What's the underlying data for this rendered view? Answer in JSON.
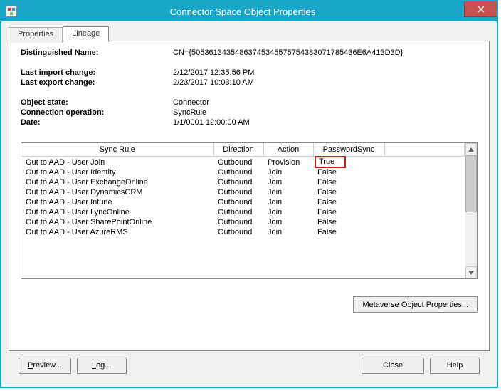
{
  "window": {
    "title": "Connector Space Object Properties"
  },
  "tabs": {
    "properties": "Properties",
    "lineage": "Lineage"
  },
  "meta": {
    "dn_label": "Distinguished Name:",
    "dn_value": "CN={50536134354863745345575754383071785436E6A413D3D}",
    "last_import_label": "Last import change:",
    "last_import_value": "2/12/2017 12:35:56 PM",
    "last_export_label": "Last export change:",
    "last_export_value": "2/23/2017 10:03:10 AM",
    "object_state_label": "Object state:",
    "object_state_value": "Connector",
    "conn_op_label": "Connection operation:",
    "conn_op_value": "SyncRule",
    "date_label": "Date:",
    "date_value": "1/1/0001 12:00:00 AM"
  },
  "columns": {
    "syncrule": "Sync Rule",
    "direction": "Direction",
    "action": "Action",
    "passwordsync": "PasswordSync"
  },
  "rows": [
    {
      "rule": "Out to AAD - User Join",
      "dir": "Outbound",
      "act": "Provision",
      "ps": "True"
    },
    {
      "rule": "Out to AAD - User Identity",
      "dir": "Outbound",
      "act": "Join",
      "ps": "False"
    },
    {
      "rule": "Out to AAD - User ExchangeOnline",
      "dir": "Outbound",
      "act": "Join",
      "ps": "False"
    },
    {
      "rule": "Out to AAD - User DynamicsCRM",
      "dir": "Outbound",
      "act": "Join",
      "ps": "False"
    },
    {
      "rule": "Out to AAD - User Intune",
      "dir": "Outbound",
      "act": "Join",
      "ps": "False"
    },
    {
      "rule": "Out to AAD - User LyncOnline",
      "dir": "Outbound",
      "act": "Join",
      "ps": "False"
    },
    {
      "rule": "Out to AAD - User SharePointOnline",
      "dir": "Outbound",
      "act": "Join",
      "ps": "False"
    },
    {
      "rule": "Out to AAD - User AzureRMS",
      "dir": "Outbound",
      "act": "Join",
      "ps": "False"
    }
  ],
  "buttons": {
    "mv_props": "Metaverse Object Properties...",
    "preview": "Preview...",
    "log": "Log...",
    "close": "Close",
    "help": "Help"
  }
}
